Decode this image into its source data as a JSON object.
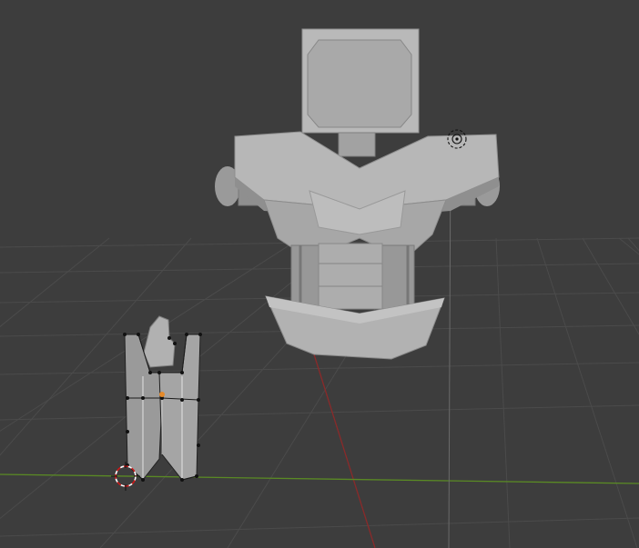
{
  "viewport": {
    "background": "#3d3d3d",
    "grid_color": "#4a4a4a",
    "x_axis_color": "#8a2a2a",
    "y_axis_color": "#5a8a24",
    "z_axis_color": "#707070"
  },
  "objects": [
    {
      "name": "armor-torso-mesh",
      "mode": "object",
      "color": "#a8a8a8"
    },
    {
      "name": "edited-piece-mesh",
      "mode": "edit",
      "color": "#9e9e9e"
    }
  ],
  "overlays": {
    "cursor": "3d-cursor-icon",
    "light": "light-probe-icon",
    "origin_color": "#e58a2a"
  }
}
